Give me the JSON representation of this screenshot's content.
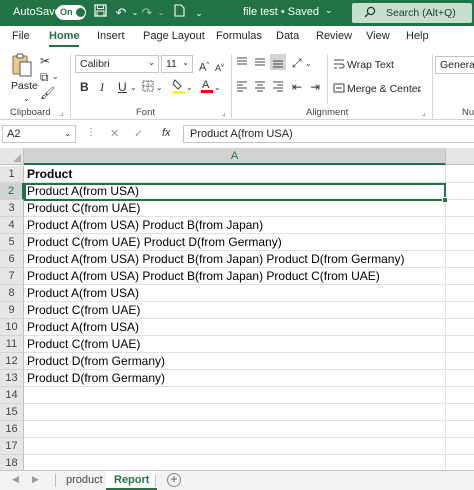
{
  "titlebar": {
    "autosave_label": "AutoSave",
    "autosave_state": "On",
    "document_title": "file test • Saved",
    "title_caret": "⌄",
    "search_placeholder": "Search (Alt+Q)",
    "icons": [
      "save-icon",
      "undo-icon",
      "redo-icon",
      "new-file-icon",
      "customize-icon"
    ],
    "brand_color": "#217346"
  },
  "tabs": {
    "items": [
      "File",
      "Home",
      "Insert",
      "Page Layout",
      "Formulas",
      "Data",
      "Review",
      "View",
      "Help"
    ],
    "active": "Home"
  },
  "ribbon": {
    "clipboard": {
      "paste_label": "Paste",
      "group_label": "Clipboard"
    },
    "font": {
      "font_name": "Calibri",
      "font_size": "11",
      "bold": "B",
      "italic": "I",
      "underline": "U",
      "group_label": "Font",
      "fill_color": "#ffff00",
      "font_color": "#ff0000"
    },
    "alignment": {
      "wrap_text": "Wrap Text",
      "merge_center": "Merge & Center",
      "group_label": "Alignment"
    },
    "number": {
      "format": "General",
      "group_label_partial": "Nu"
    }
  },
  "formula_bar": {
    "name_box": "A2",
    "fx": "fx",
    "formula": "Product A(from USA)"
  },
  "grid": {
    "column_header": "A",
    "rows": [
      {
        "num": "1",
        "value": "Product"
      },
      {
        "num": "2",
        "value": "Product A(from USA)"
      },
      {
        "num": "3",
        "value": "Product C(from UAE)"
      },
      {
        "num": "4",
        "value": "Product A(from USA) Product B(from Japan)"
      },
      {
        "num": "5",
        "value": "Product C(from UAE) Product D(from Germany)"
      },
      {
        "num": "6",
        "value": "Product A(from USA) Product B(from Japan) Product D(from Germany)"
      },
      {
        "num": "7",
        "value": "Product A(from USA) Product B(from Japan) Product C(from UAE)"
      },
      {
        "num": "8",
        "value": "Product A(from USA)"
      },
      {
        "num": "9",
        "value": "Product C(from UAE)"
      },
      {
        "num": "10",
        "value": "Product A(from USA)"
      },
      {
        "num": "11",
        "value": "Product C(from UAE)"
      },
      {
        "num": "12",
        "value": "Product D(from Germany)"
      },
      {
        "num": "13",
        "value": "Product D(from Germany)"
      },
      {
        "num": "14",
        "value": ""
      },
      {
        "num": "15",
        "value": ""
      },
      {
        "num": "16",
        "value": ""
      },
      {
        "num": "17",
        "value": ""
      },
      {
        "num": "18",
        "value": ""
      }
    ],
    "selected_cell": "A2"
  },
  "sheets": {
    "items": [
      "product",
      "Report"
    ],
    "active": "Report",
    "add_label": "+"
  }
}
